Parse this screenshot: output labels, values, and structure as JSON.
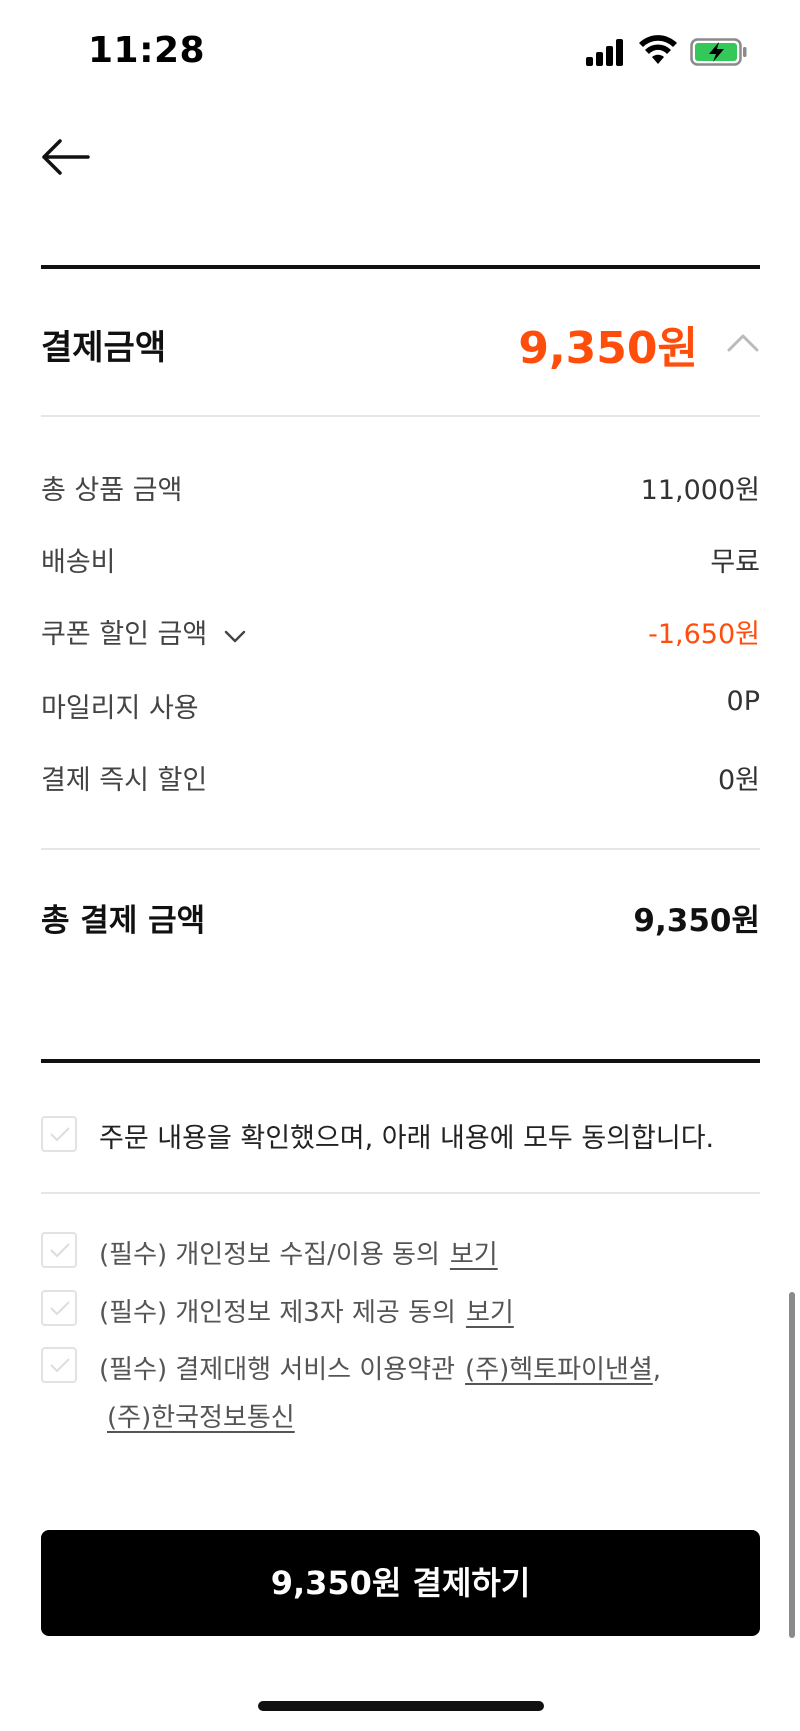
{
  "status_bar": {
    "time": "11:28"
  },
  "summary": {
    "title": "결제금액",
    "amount": "9,350원",
    "rows": [
      {
        "label": "총 상품 금액",
        "value": "11,000원"
      },
      {
        "label": "배송비",
        "value": "무료"
      },
      {
        "label": "쿠폰 할인 금액",
        "value": "-1,650원"
      },
      {
        "label": "마일리지 사용",
        "value": "0P"
      },
      {
        "label": "결제 즉시 할인",
        "value": "0원"
      }
    ],
    "total_label": "총 결제 금액",
    "total_value": "9,350원"
  },
  "agreement": {
    "all_text": "주문 내용을 확인했으며, 아래 내용에 모두 동의합니다.",
    "terms": [
      {
        "text": "(필수) 개인정보 수집/이용 동의",
        "link": "보기"
      },
      {
        "text": "(필수) 개인정보 제3자 제공 동의",
        "link": "보기"
      },
      {
        "text": "(필수) 결제대행 서비스 이용약관",
        "link": "(주)헥토파이낸셜",
        "link2": "(주)한국정보통신"
      }
    ]
  },
  "pay_button": {
    "label": "9,350원 결제하기"
  },
  "colors": {
    "accent": "#ff4d0b",
    "primary_button": "#000000"
  },
  "icons": {
    "back": "arrow-left-icon",
    "collapse": "chevron-up-icon",
    "expand": "chevron-down-icon",
    "check": "check-icon"
  }
}
